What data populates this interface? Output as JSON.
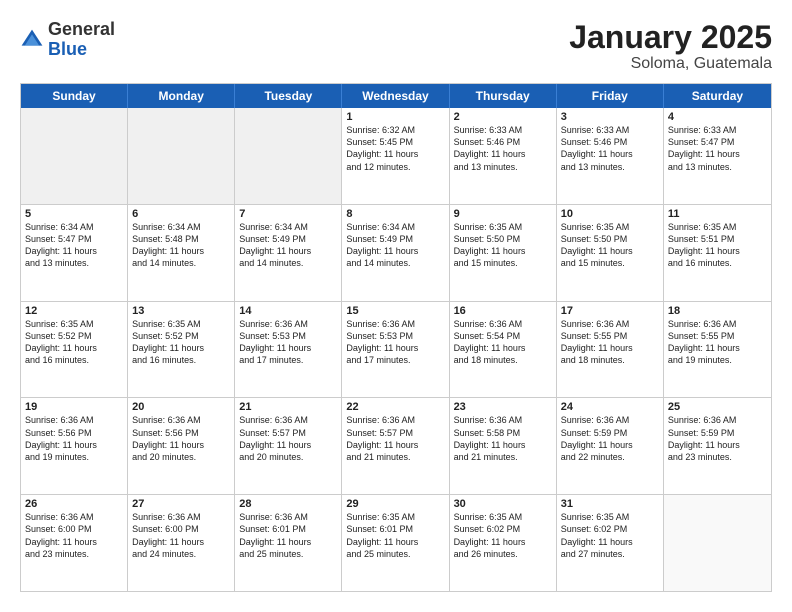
{
  "logo": {
    "general": "General",
    "blue": "Blue"
  },
  "title": "January 2025",
  "subtitle": "Soloma, Guatemala",
  "days": [
    "Sunday",
    "Monday",
    "Tuesday",
    "Wednesday",
    "Thursday",
    "Friday",
    "Saturday"
  ],
  "weeks": [
    [
      {
        "day": "",
        "text": ""
      },
      {
        "day": "",
        "text": ""
      },
      {
        "day": "",
        "text": ""
      },
      {
        "day": "1",
        "text": "Sunrise: 6:32 AM\nSunset: 5:45 PM\nDaylight: 11 hours\nand 12 minutes."
      },
      {
        "day": "2",
        "text": "Sunrise: 6:33 AM\nSunset: 5:46 PM\nDaylight: 11 hours\nand 13 minutes."
      },
      {
        "day": "3",
        "text": "Sunrise: 6:33 AM\nSunset: 5:46 PM\nDaylight: 11 hours\nand 13 minutes."
      },
      {
        "day": "4",
        "text": "Sunrise: 6:33 AM\nSunset: 5:47 PM\nDaylight: 11 hours\nand 13 minutes."
      }
    ],
    [
      {
        "day": "5",
        "text": "Sunrise: 6:34 AM\nSunset: 5:47 PM\nDaylight: 11 hours\nand 13 minutes."
      },
      {
        "day": "6",
        "text": "Sunrise: 6:34 AM\nSunset: 5:48 PM\nDaylight: 11 hours\nand 14 minutes."
      },
      {
        "day": "7",
        "text": "Sunrise: 6:34 AM\nSunset: 5:49 PM\nDaylight: 11 hours\nand 14 minutes."
      },
      {
        "day": "8",
        "text": "Sunrise: 6:34 AM\nSunset: 5:49 PM\nDaylight: 11 hours\nand 14 minutes."
      },
      {
        "day": "9",
        "text": "Sunrise: 6:35 AM\nSunset: 5:50 PM\nDaylight: 11 hours\nand 15 minutes."
      },
      {
        "day": "10",
        "text": "Sunrise: 6:35 AM\nSunset: 5:50 PM\nDaylight: 11 hours\nand 15 minutes."
      },
      {
        "day": "11",
        "text": "Sunrise: 6:35 AM\nSunset: 5:51 PM\nDaylight: 11 hours\nand 16 minutes."
      }
    ],
    [
      {
        "day": "12",
        "text": "Sunrise: 6:35 AM\nSunset: 5:52 PM\nDaylight: 11 hours\nand 16 minutes."
      },
      {
        "day": "13",
        "text": "Sunrise: 6:35 AM\nSunset: 5:52 PM\nDaylight: 11 hours\nand 16 minutes."
      },
      {
        "day": "14",
        "text": "Sunrise: 6:36 AM\nSunset: 5:53 PM\nDaylight: 11 hours\nand 17 minutes."
      },
      {
        "day": "15",
        "text": "Sunrise: 6:36 AM\nSunset: 5:53 PM\nDaylight: 11 hours\nand 17 minutes."
      },
      {
        "day": "16",
        "text": "Sunrise: 6:36 AM\nSunset: 5:54 PM\nDaylight: 11 hours\nand 18 minutes."
      },
      {
        "day": "17",
        "text": "Sunrise: 6:36 AM\nSunset: 5:55 PM\nDaylight: 11 hours\nand 18 minutes."
      },
      {
        "day": "18",
        "text": "Sunrise: 6:36 AM\nSunset: 5:55 PM\nDaylight: 11 hours\nand 19 minutes."
      }
    ],
    [
      {
        "day": "19",
        "text": "Sunrise: 6:36 AM\nSunset: 5:56 PM\nDaylight: 11 hours\nand 19 minutes."
      },
      {
        "day": "20",
        "text": "Sunrise: 6:36 AM\nSunset: 5:56 PM\nDaylight: 11 hours\nand 20 minutes."
      },
      {
        "day": "21",
        "text": "Sunrise: 6:36 AM\nSunset: 5:57 PM\nDaylight: 11 hours\nand 20 minutes."
      },
      {
        "day": "22",
        "text": "Sunrise: 6:36 AM\nSunset: 5:57 PM\nDaylight: 11 hours\nand 21 minutes."
      },
      {
        "day": "23",
        "text": "Sunrise: 6:36 AM\nSunset: 5:58 PM\nDaylight: 11 hours\nand 21 minutes."
      },
      {
        "day": "24",
        "text": "Sunrise: 6:36 AM\nSunset: 5:59 PM\nDaylight: 11 hours\nand 22 minutes."
      },
      {
        "day": "25",
        "text": "Sunrise: 6:36 AM\nSunset: 5:59 PM\nDaylight: 11 hours\nand 23 minutes."
      }
    ],
    [
      {
        "day": "26",
        "text": "Sunrise: 6:36 AM\nSunset: 6:00 PM\nDaylight: 11 hours\nand 23 minutes."
      },
      {
        "day": "27",
        "text": "Sunrise: 6:36 AM\nSunset: 6:00 PM\nDaylight: 11 hours\nand 24 minutes."
      },
      {
        "day": "28",
        "text": "Sunrise: 6:36 AM\nSunset: 6:01 PM\nDaylight: 11 hours\nand 25 minutes."
      },
      {
        "day": "29",
        "text": "Sunrise: 6:35 AM\nSunset: 6:01 PM\nDaylight: 11 hours\nand 25 minutes."
      },
      {
        "day": "30",
        "text": "Sunrise: 6:35 AM\nSunset: 6:02 PM\nDaylight: 11 hours\nand 26 minutes."
      },
      {
        "day": "31",
        "text": "Sunrise: 6:35 AM\nSunset: 6:02 PM\nDaylight: 11 hours\nand 27 minutes."
      },
      {
        "day": "",
        "text": ""
      }
    ]
  ]
}
